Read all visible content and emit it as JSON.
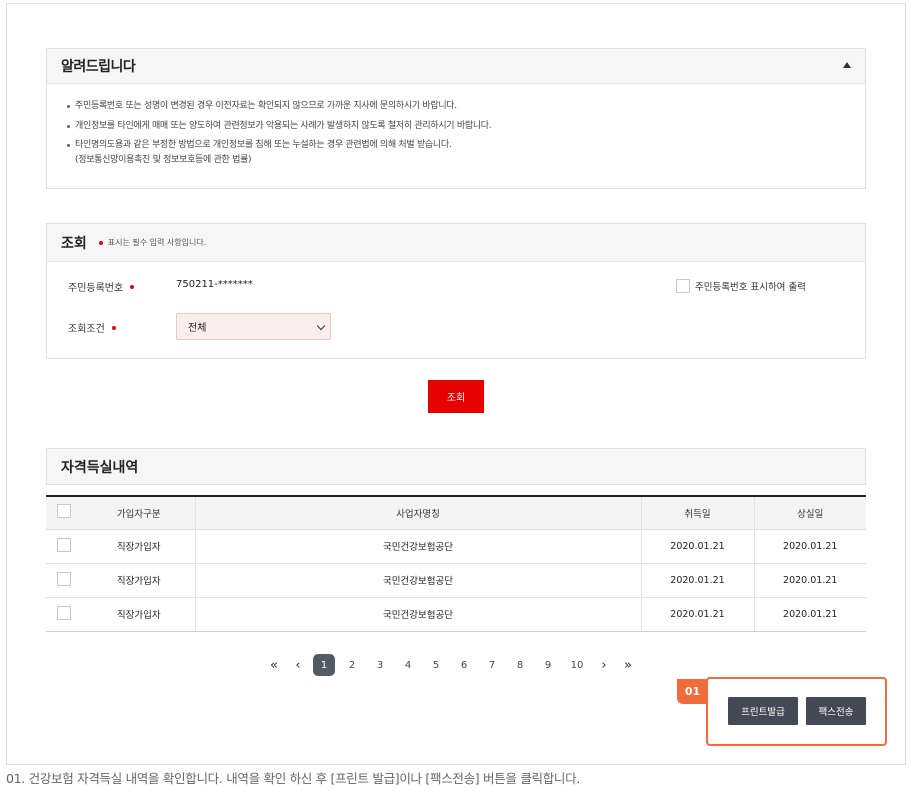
{
  "notice": {
    "title": "알려드립니다",
    "lines": [
      "주민등록번호 또는 성명이 변경된 경우 이전자료는 확인되지 않으므로 가까운 지사에 문의하시기 바랍니다.",
      "개인정보를 타인에게 매매 또는 양도하여 관련정보가 악용되는 사례가 발생하지 않도록 철저히 관리하시기 바랍니다.",
      "타인명의도용과 같은 부정한 방법으로 개인정보를 침해 또는 누설하는 경우 관련법에 의해 처벌 받습니다."
    ],
    "sub_line": "(정보통신망이용촉진 및 정보보호등에 관한 법률)"
  },
  "search": {
    "title": "조회",
    "hint": "표시는 필수 입력 사항입니다.",
    "ssn_label": "주민등록번호",
    "ssn_value": "750211-*******",
    "show_ssn_label": "주민등록번호 표시하여 출력",
    "condition_label": "조회조건",
    "condition_value": "전체",
    "query_button": "조회"
  },
  "history": {
    "title": "자격득실내역",
    "columns": [
      "가입자구분",
      "사업자명칭",
      "취득일",
      "상실일"
    ],
    "rows": [
      {
        "type": "직장가입자",
        "name": "국민건강보험공단",
        "acquired": "2020.01.21",
        "lost": "2020.01.21"
      },
      {
        "type": "직장가입자",
        "name": "국민건강보험공단",
        "acquired": "2020.01.21",
        "lost": "2020.01.21"
      },
      {
        "type": "직장가입자",
        "name": "국민건강보험공단",
        "acquired": "2020.01.21",
        "lost": "2020.01.21"
      }
    ]
  },
  "pagination": {
    "first": "«",
    "prev": "‹",
    "pages": [
      "1",
      "2",
      "3",
      "4",
      "5",
      "6",
      "7",
      "8",
      "9",
      "10"
    ],
    "current": "1",
    "next": "›",
    "last": "»"
  },
  "actions": {
    "step_tag": "01",
    "print_button": "프린트발급",
    "fax_button": "팩스전송"
  },
  "caption": "01. 건강보험 자격득실 내역을 확인합니다. 내역을 확인 하신 후 [프린트 발급]이나 [팩스전송] 버튼을 클릭합니다.",
  "colors": {
    "accent_red": "#e60000",
    "highlight_orange": "#f26b3a",
    "dark_button": "#434a56"
  },
  "icons": {
    "collapse": "chevron-up-icon",
    "select": "chevron-down-icon"
  }
}
